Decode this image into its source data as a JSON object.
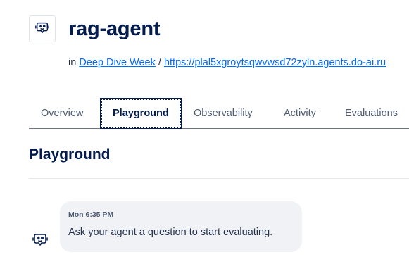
{
  "agent": {
    "icon": "agent-robot-icon",
    "name": "rag-agent"
  },
  "breadcrumb": {
    "prefix": "in",
    "project_link": "Deep Dive Week",
    "separator": "/",
    "endpoint_link": "https://plal5xgroytsqwvwsd72zyln.agents.do-ai.ru"
  },
  "tabs": [
    {
      "label": "Overview"
    },
    {
      "label": "Playground",
      "active": true
    },
    {
      "label": "Observability"
    },
    {
      "label": "Activity"
    },
    {
      "label": "Evaluations"
    }
  ],
  "playground": {
    "title": "Playground",
    "message": {
      "icon": "agent-robot-icon",
      "time": "Mon 6:35 PM",
      "text": "Ask your agent a question to start evaluating."
    }
  },
  "colors": {
    "text_primary": "#031b4e",
    "link": "#0069ff",
    "bubble_bg": "#f0f2f5"
  }
}
